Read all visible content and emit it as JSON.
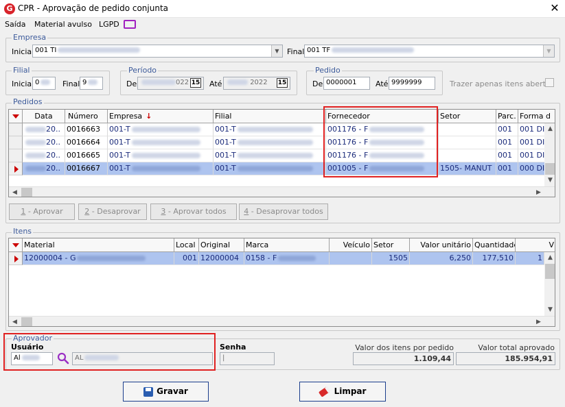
{
  "window": {
    "title": "CPR - Aprovação de pedido conjunta",
    "close": "✕",
    "logo": "G"
  },
  "menu": {
    "items": [
      "Saída",
      "Material avulso",
      "LGPD"
    ]
  },
  "empresa": {
    "title": "Empresa",
    "inicial_label": "Inicial",
    "inicial_value": "001 TI",
    "final_label": "Final",
    "final_value": "001 TF"
  },
  "filial": {
    "title": "Filial",
    "inicial_label": "Inicial",
    "inicial_value": "0",
    "final_label": "Final",
    "final_value": "9"
  },
  "periodo": {
    "title": "Período",
    "de_label": "De",
    "de_value": "022",
    "ate_label": "Até",
    "ate_value": "2022",
    "cal_icon": "15"
  },
  "pedido": {
    "title": "Pedido",
    "de_label": "De",
    "de_value": "0000001",
    "ate_label": "Até",
    "ate_value": "9999999"
  },
  "trazer": {
    "label": "Trazer apenas itens abertos"
  },
  "pedidos": {
    "title": "Pedidos",
    "columns": [
      "Data",
      "Número",
      "Empresa",
      "Filial",
      "Fornecedor",
      "Setor",
      "Parc.",
      "Forma d"
    ],
    "rows": [
      {
        "data": "20..",
        "numero": "0016663",
        "empresa": "001-T",
        "filial": "001-T",
        "fornecedor": "001176 - F",
        "setor": "",
        "parc": "001",
        "forma": "001 DI"
      },
      {
        "data": "20..",
        "numero": "0016664",
        "empresa": "001-T",
        "filial": "001-T",
        "fornecedor": "001176 - F",
        "setor": "",
        "parc": "001",
        "forma": "001 DI"
      },
      {
        "data": "20..",
        "numero": "0016665",
        "empresa": "001-T",
        "filial": "001-T",
        "fornecedor": "001176 - F",
        "setor": "",
        "parc": "001",
        "forma": "001 DI"
      },
      {
        "data": "20..",
        "numero": "0016667",
        "empresa": "001-T",
        "filial": "001-T",
        "fornecedor": "001005 - F",
        "setor": "1505- MANUT",
        "parc": "001",
        "forma": "000 DI"
      }
    ]
  },
  "actions": {
    "aprovar_key": "1",
    "aprovar": " - Aprovar",
    "desaprovar_key": "2",
    "desaprovar": " - Desaprovar",
    "aprovar_todos_key": "3",
    "aprovar_todos": " - Aprovar todos",
    "desaprovar_todos_key": "4",
    "desaprovar_todos": " - Desaprovar todos"
  },
  "itens": {
    "title": "Itens",
    "columns": [
      "Material",
      "Local",
      "Original",
      "Marca",
      "Veículo",
      "Setor",
      "Valor unitário",
      "Quantidade",
      "V"
    ],
    "rows": [
      {
        "material": "12000004 - G",
        "local": "001",
        "original": "12000004",
        "marca": "0158 - F",
        "veiculo": "",
        "setor": "1505",
        "valor_unitario": "6,250",
        "quantidade": "177,510",
        "v": "1"
      }
    ]
  },
  "aprovador": {
    "title": "Aprovador",
    "usuario_label": "Usuário",
    "usuario_code": "Al",
    "usuario_name": "AL"
  },
  "senha": {
    "label": "Senha",
    "value": "|"
  },
  "totais": {
    "valor_itens_label": "Valor dos itens por pedido",
    "valor_itens": "1.109,44",
    "valor_total_label": "Valor total aprovado",
    "valor_total": "185.954,91"
  },
  "buttons": {
    "gravar": "Gravar",
    "limpar": "Limpar"
  }
}
